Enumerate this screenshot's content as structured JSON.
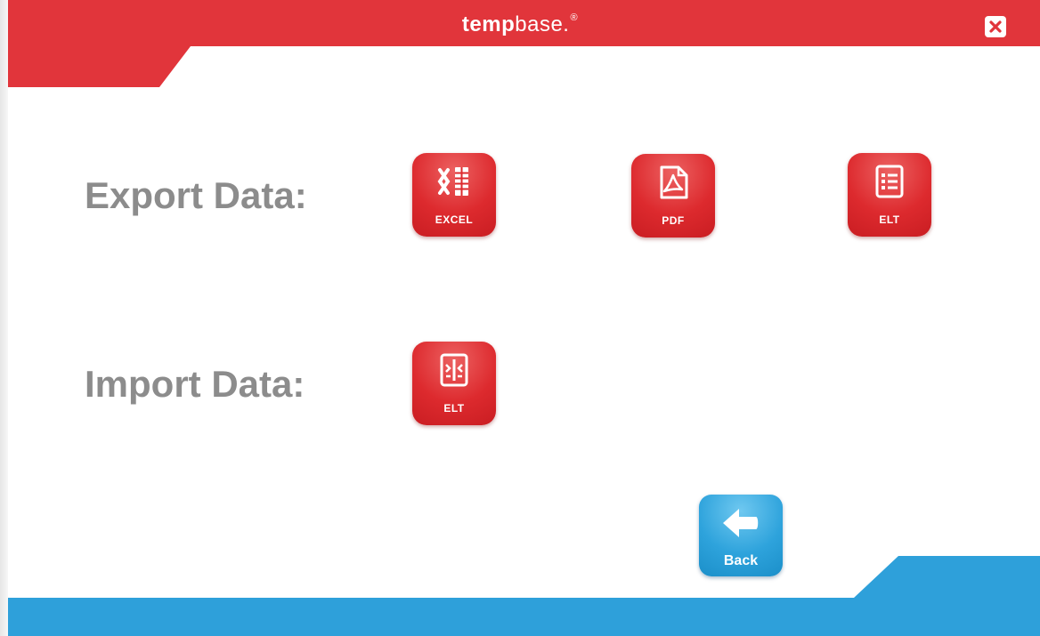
{
  "header": {
    "brand_bold": "temp",
    "brand_light": "base.",
    "brand_registered": "®",
    "close_icon": "close-x-icon"
  },
  "export": {
    "label": "Export Data:",
    "buttons": [
      {
        "label": "EXCEL",
        "icon": "excel-icon"
      },
      {
        "label": "PDF",
        "icon": "pdf-icon"
      },
      {
        "label": "ELT",
        "icon": "list-document-icon"
      }
    ]
  },
  "import": {
    "label": "Import Data:",
    "buttons": [
      {
        "label": "ELT",
        "icon": "import-document-icon"
      }
    ]
  },
  "footer": {
    "back_label": "Back",
    "back_icon": "arrow-left-icon"
  },
  "colors": {
    "header_red": "#e1353b",
    "tile_red": "#dd2a2e",
    "footer_blue": "#2ea0da",
    "label_gray": "#8c8c8c"
  }
}
